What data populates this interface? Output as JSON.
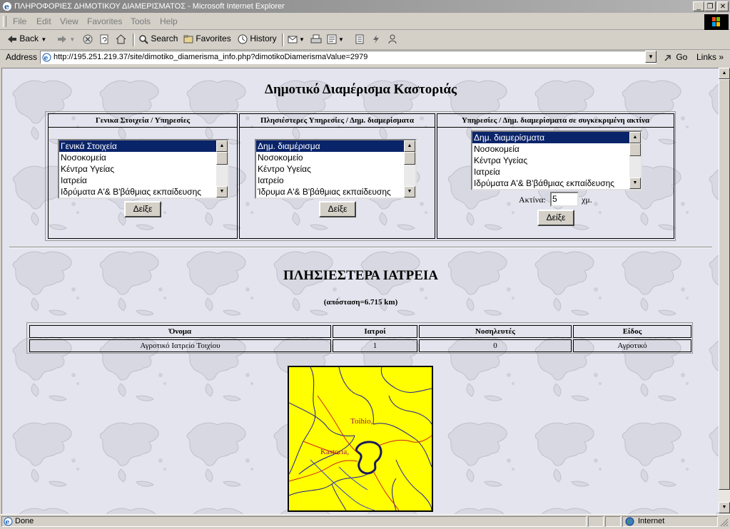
{
  "window": {
    "title": "ΠΛΗΡΟΦΟΡΙΕΣ ΔΗΜΟΤΙΚΟΥ ΔΙΑΜΕΡΙΣΜΑΤΟΣ - Microsoft Internet Explorer",
    "controls": [
      "minimize",
      "maximize",
      "close"
    ]
  },
  "menu": [
    "File",
    "Edit",
    "View",
    "Favorites",
    "Tools",
    "Help"
  ],
  "toolbar": {
    "back": "Back",
    "search": "Search",
    "favorites": "Favorites",
    "history": "History"
  },
  "address": {
    "label": "Address",
    "url": "http://195.251.219.37/site/dimotiko_diamerisma_info.php?dimotikoDiamerismaValue=2979",
    "go": "Go",
    "links": "Links"
  },
  "page": {
    "title": "Δημοτικό Διαμέρισμα Καστοριάς",
    "panel1": {
      "header": "Γενικα Στοιχεία / Υπηρεσίες",
      "items": [
        "Γενικά Στοιχεία",
        "Νοσοκομεία",
        "Κέντρα Υγείας",
        "Ιατρεία",
        "Ιδρύματα Α'& Β'βάθμιας εκπαίδευσης"
      ],
      "selected": 0,
      "button": "Δείξε"
    },
    "panel2": {
      "header": "Πλησιέστερες Υπηρεσίες / Δημ. διαμερίσματα",
      "items": [
        "Δημ. διαμέρισμα",
        "Νοσοκομείο",
        "Κέντρο Υγείας",
        "Ιατρείο",
        "Ίδρυμα Α'& Β'βάθμιας εκπαίδευσης"
      ],
      "selected": 0,
      "button": "Δείξε"
    },
    "panel3": {
      "header": "Υπηρεσίες / Δημ. διαμερίσματα σε συγκεκριμένη ακτίνα",
      "items": [
        "Δημ. διαμερίσματα",
        "Νοσοκομεία",
        "Κέντρα Υγείας",
        "Ιατρεία",
        "Ιδρύματα Α'& Β'βάθμιας εκπαίδευσης"
      ],
      "selected": 0,
      "radius_label": "Ακτίνα:",
      "radius_value": "5",
      "radius_unit": "χμ.",
      "button": "Δείξε"
    },
    "results": {
      "heading": "ΠΛΗΣΙΕΣΤΕΡΑ ΙΑΤΡΕΙΑ",
      "distance": "(απόσταση=6.715 km)",
      "columns": [
        "Όνομα",
        "Ιατροί",
        "Νοσηλευτές",
        "Είδος"
      ],
      "rows": [
        [
          "Αγροτικό Ιατρείο Τοιχίου",
          "1",
          "0",
          "Αγροτικό"
        ]
      ]
    },
    "map": {
      "labels": [
        "Toihio,",
        "Kastoria,"
      ],
      "colors": {
        "background": "#ffff00",
        "roads_main": "#1a1aa0",
        "roads_secondary": "#cc2222",
        "label": "#a01050"
      }
    }
  },
  "status": {
    "text": "Done",
    "zone": "Internet"
  }
}
